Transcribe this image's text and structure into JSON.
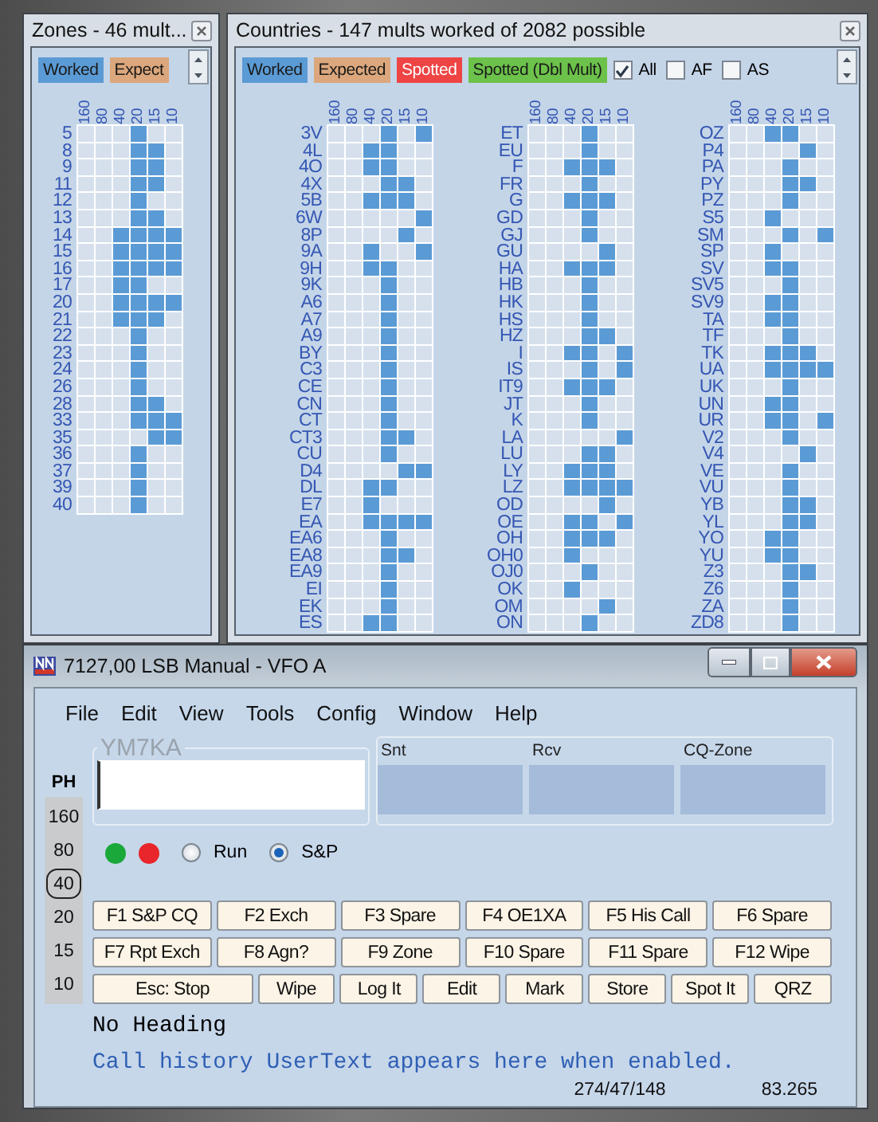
{
  "zones_panel": {
    "title": "Zones - 46 mult...",
    "legend": [
      {
        "label": "Worked",
        "color": "#5b9bd5"
      },
      {
        "label": "Expect",
        "color": "#dca77c"
      }
    ],
    "bands": [
      "160",
      "80",
      "40",
      "20",
      "15",
      "10"
    ],
    "rows": [
      {
        "label": "5",
        "worked": [
          false,
          false,
          false,
          true,
          false,
          false
        ]
      },
      {
        "label": "8",
        "worked": [
          false,
          false,
          false,
          true,
          true,
          false
        ]
      },
      {
        "label": "9",
        "worked": [
          false,
          false,
          false,
          true,
          true,
          false
        ]
      },
      {
        "label": "11",
        "worked": [
          false,
          false,
          false,
          true,
          true,
          false
        ]
      },
      {
        "label": "12",
        "worked": [
          false,
          false,
          false,
          true,
          false,
          false
        ]
      },
      {
        "label": "13",
        "worked": [
          false,
          false,
          false,
          true,
          true,
          false
        ]
      },
      {
        "label": "14",
        "worked": [
          false,
          false,
          true,
          true,
          true,
          true
        ]
      },
      {
        "label": "15",
        "worked": [
          false,
          false,
          true,
          true,
          true,
          true
        ]
      },
      {
        "label": "16",
        "worked": [
          false,
          false,
          true,
          true,
          true,
          true
        ]
      },
      {
        "label": "17",
        "worked": [
          false,
          false,
          true,
          true,
          false,
          false
        ]
      },
      {
        "label": "20",
        "worked": [
          false,
          false,
          true,
          true,
          true,
          true
        ]
      },
      {
        "label": "21",
        "worked": [
          false,
          false,
          true,
          true,
          true,
          false
        ]
      },
      {
        "label": "22",
        "worked": [
          false,
          false,
          false,
          true,
          false,
          false
        ]
      },
      {
        "label": "23",
        "worked": [
          false,
          false,
          false,
          true,
          false,
          false
        ]
      },
      {
        "label": "24",
        "worked": [
          false,
          false,
          false,
          true,
          false,
          false
        ]
      },
      {
        "label": "26",
        "worked": [
          false,
          false,
          false,
          true,
          false,
          false
        ]
      },
      {
        "label": "28",
        "worked": [
          false,
          false,
          false,
          true,
          true,
          false
        ]
      },
      {
        "label": "33",
        "worked": [
          false,
          false,
          false,
          true,
          true,
          true
        ]
      },
      {
        "label": "35",
        "worked": [
          false,
          false,
          false,
          false,
          true,
          true
        ]
      },
      {
        "label": "36",
        "worked": [
          false,
          false,
          false,
          true,
          false,
          false
        ]
      },
      {
        "label": "37",
        "worked": [
          false,
          false,
          false,
          true,
          false,
          false
        ]
      },
      {
        "label": "39",
        "worked": [
          false,
          false,
          false,
          true,
          false,
          false
        ]
      },
      {
        "label": "40",
        "worked": [
          false,
          false,
          false,
          true,
          false,
          false
        ]
      }
    ]
  },
  "countries_panel": {
    "title": "Countries - 147 mults worked of 2082 possible",
    "legend": [
      {
        "label": "Worked",
        "color": "#5b9bd5"
      },
      {
        "label": "Expected",
        "color": "#dca77c"
      },
      {
        "label": "Spotted",
        "color": "#ee4444"
      },
      {
        "label": "Spotted (Dbl Mult)",
        "color": "#6cc24a"
      }
    ],
    "filters": [
      {
        "label": "All",
        "checked": true
      },
      {
        "label": "AF",
        "checked": false
      },
      {
        "label": "AS",
        "checked": false
      }
    ],
    "columns": [
      {
        "bands": [
          "160",
          "80",
          "40",
          "20",
          "15",
          "10"
        ],
        "rows": [
          {
            "label": "3V",
            "worked": [
              false,
              false,
              false,
              true,
              false,
              true
            ]
          },
          {
            "label": "4L",
            "worked": [
              false,
              false,
              true,
              true,
              false,
              false
            ]
          },
          {
            "label": "4O",
            "worked": [
              false,
              false,
              true,
              true,
              false,
              false
            ]
          },
          {
            "label": "4X",
            "worked": [
              false,
              false,
              false,
              true,
              true,
              false
            ]
          },
          {
            "label": "5B",
            "worked": [
              false,
              false,
              true,
              true,
              true,
              false
            ]
          },
          {
            "label": "6W",
            "worked": [
              false,
              false,
              false,
              false,
              false,
              true
            ]
          },
          {
            "label": "8P",
            "worked": [
              false,
              false,
              false,
              false,
              true,
              false
            ]
          },
          {
            "label": "9A",
            "worked": [
              false,
              false,
              true,
              false,
              false,
              true
            ]
          },
          {
            "label": "9H",
            "worked": [
              false,
              false,
              true,
              true,
              false,
              false
            ]
          },
          {
            "label": "9K",
            "worked": [
              false,
              false,
              false,
              true,
              false,
              false
            ]
          },
          {
            "label": "A6",
            "worked": [
              false,
              false,
              false,
              true,
              false,
              false
            ]
          },
          {
            "label": "A7",
            "worked": [
              false,
              false,
              false,
              true,
              false,
              false
            ]
          },
          {
            "label": "A9",
            "worked": [
              false,
              false,
              false,
              true,
              false,
              false
            ]
          },
          {
            "label": "BY",
            "worked": [
              false,
              false,
              false,
              true,
              false,
              false
            ]
          },
          {
            "label": "C3",
            "worked": [
              false,
              false,
              false,
              true,
              false,
              false
            ]
          },
          {
            "label": "CE",
            "worked": [
              false,
              false,
              false,
              true,
              false,
              false
            ]
          },
          {
            "label": "CN",
            "worked": [
              false,
              false,
              false,
              true,
              false,
              false
            ]
          },
          {
            "label": "CT",
            "worked": [
              false,
              false,
              false,
              true,
              false,
              false
            ]
          },
          {
            "label": "CT3",
            "worked": [
              false,
              false,
              false,
              true,
              true,
              false
            ]
          },
          {
            "label": "CU",
            "worked": [
              false,
              false,
              false,
              true,
              false,
              false
            ]
          },
          {
            "label": "D4",
            "worked": [
              false,
              false,
              false,
              false,
              true,
              true
            ]
          },
          {
            "label": "DL",
            "worked": [
              false,
              false,
              true,
              true,
              false,
              false
            ]
          },
          {
            "label": "E7",
            "worked": [
              false,
              false,
              true,
              false,
              false,
              false
            ]
          },
          {
            "label": "EA",
            "worked": [
              false,
              false,
              true,
              true,
              true,
              true
            ]
          },
          {
            "label": "EA6",
            "worked": [
              false,
              false,
              false,
              true,
              false,
              false
            ]
          },
          {
            "label": "EA8",
            "worked": [
              false,
              false,
              false,
              true,
              true,
              false
            ]
          },
          {
            "label": "EA9",
            "worked": [
              false,
              false,
              false,
              true,
              false,
              false
            ]
          },
          {
            "label": "EI",
            "worked": [
              false,
              false,
              false,
              true,
              false,
              false
            ]
          },
          {
            "label": "EK",
            "worked": [
              false,
              false,
              false,
              true,
              false,
              false
            ]
          },
          {
            "label": "ES",
            "worked": [
              false,
              false,
              true,
              true,
              false,
              false
            ]
          }
        ]
      },
      {
        "bands": [
          "160",
          "80",
          "40",
          "20",
          "15",
          "10"
        ],
        "rows": [
          {
            "label": "ET",
            "worked": [
              false,
              false,
              false,
              true,
              false,
              false
            ]
          },
          {
            "label": "EU",
            "worked": [
              false,
              false,
              false,
              true,
              false,
              false
            ]
          },
          {
            "label": "F",
            "worked": [
              false,
              false,
              true,
              true,
              true,
              false
            ]
          },
          {
            "label": "FR",
            "worked": [
              false,
              false,
              false,
              true,
              false,
              false
            ]
          },
          {
            "label": "G",
            "worked": [
              false,
              false,
              true,
              true,
              true,
              false
            ]
          },
          {
            "label": "GD",
            "worked": [
              false,
              false,
              false,
              true,
              false,
              false
            ]
          },
          {
            "label": "GJ",
            "worked": [
              false,
              false,
              false,
              true,
              false,
              false
            ]
          },
          {
            "label": "GU",
            "worked": [
              false,
              false,
              false,
              false,
              true,
              false
            ]
          },
          {
            "label": "HA",
            "worked": [
              false,
              false,
              true,
              true,
              true,
              false
            ]
          },
          {
            "label": "HB",
            "worked": [
              false,
              false,
              false,
              true,
              false,
              false
            ]
          },
          {
            "label": "HK",
            "worked": [
              false,
              false,
              false,
              true,
              false,
              false
            ]
          },
          {
            "label": "HS",
            "worked": [
              false,
              false,
              false,
              true,
              false,
              false
            ]
          },
          {
            "label": "HZ",
            "worked": [
              false,
              false,
              false,
              true,
              true,
              false
            ]
          },
          {
            "label": "I",
            "worked": [
              false,
              false,
              true,
              true,
              false,
              true
            ]
          },
          {
            "label": "IS",
            "worked": [
              false,
              false,
              false,
              true,
              false,
              true
            ]
          },
          {
            "label": "IT9",
            "worked": [
              false,
              false,
              true,
              true,
              true,
              false
            ]
          },
          {
            "label": "JT",
            "worked": [
              false,
              false,
              false,
              true,
              false,
              false
            ]
          },
          {
            "label": "K",
            "worked": [
              false,
              false,
              false,
              true,
              false,
              false
            ]
          },
          {
            "label": "LA",
            "worked": [
              false,
              false,
              false,
              false,
              false,
              true
            ]
          },
          {
            "label": "LU",
            "worked": [
              false,
              false,
              false,
              true,
              true,
              false
            ]
          },
          {
            "label": "LY",
            "worked": [
              false,
              false,
              true,
              true,
              true,
              false
            ]
          },
          {
            "label": "LZ",
            "worked": [
              false,
              false,
              true,
              true,
              true,
              true
            ]
          },
          {
            "label": "OD",
            "worked": [
              false,
              false,
              false,
              false,
              true,
              false
            ]
          },
          {
            "label": "OE",
            "worked": [
              false,
              false,
              true,
              true,
              false,
              true
            ]
          },
          {
            "label": "OH",
            "worked": [
              false,
              false,
              true,
              true,
              true,
              false
            ]
          },
          {
            "label": "OH0",
            "worked": [
              false,
              false,
              true,
              false,
              false,
              false
            ]
          },
          {
            "label": "OJ0",
            "worked": [
              false,
              false,
              false,
              true,
              false,
              false
            ]
          },
          {
            "label": "OK",
            "worked": [
              false,
              false,
              true,
              false,
              false,
              false
            ]
          },
          {
            "label": "OM",
            "worked": [
              false,
              false,
              false,
              false,
              true,
              false
            ]
          },
          {
            "label": "ON",
            "worked": [
              false,
              false,
              false,
              true,
              false,
              false
            ]
          }
        ]
      },
      {
        "bands": [
          "160",
          "80",
          "40",
          "20",
          "15",
          "10"
        ],
        "rows": [
          {
            "label": "OZ",
            "worked": [
              false,
              false,
              true,
              true,
              false,
              false
            ]
          },
          {
            "label": "P4",
            "worked": [
              false,
              false,
              false,
              false,
              true,
              false
            ]
          },
          {
            "label": "PA",
            "worked": [
              false,
              false,
              false,
              true,
              false,
              false
            ]
          },
          {
            "label": "PY",
            "worked": [
              false,
              false,
              false,
              true,
              true,
              false
            ]
          },
          {
            "label": "PZ",
            "worked": [
              false,
              false,
              false,
              true,
              false,
              false
            ]
          },
          {
            "label": "S5",
            "worked": [
              false,
              false,
              true,
              false,
              false,
              false
            ]
          },
          {
            "label": "SM",
            "worked": [
              false,
              false,
              false,
              true,
              false,
              true
            ]
          },
          {
            "label": "SP",
            "worked": [
              false,
              false,
              true,
              false,
              false,
              false
            ]
          },
          {
            "label": "SV",
            "worked": [
              false,
              false,
              true,
              true,
              false,
              false
            ]
          },
          {
            "label": "SV5",
            "worked": [
              false,
              false,
              false,
              true,
              false,
              false
            ]
          },
          {
            "label": "SV9",
            "worked": [
              false,
              false,
              true,
              true,
              false,
              false
            ]
          },
          {
            "label": "TA",
            "worked": [
              false,
              false,
              true,
              true,
              false,
              false
            ]
          },
          {
            "label": "TF",
            "worked": [
              false,
              false,
              false,
              true,
              false,
              false
            ]
          },
          {
            "label": "TK",
            "worked": [
              false,
              false,
              true,
              true,
              true,
              false
            ]
          },
          {
            "label": "UA",
            "worked": [
              false,
              false,
              true,
              true,
              true,
              true
            ]
          },
          {
            "label": "UK",
            "worked": [
              false,
              false,
              false,
              true,
              false,
              false
            ]
          },
          {
            "label": "UN",
            "worked": [
              false,
              false,
              true,
              true,
              false,
              false
            ]
          },
          {
            "label": "UR",
            "worked": [
              false,
              false,
              true,
              true,
              false,
              true
            ]
          },
          {
            "label": "V2",
            "worked": [
              false,
              false,
              false,
              true,
              false,
              false
            ]
          },
          {
            "label": "V4",
            "worked": [
              false,
              false,
              false,
              false,
              true,
              false
            ]
          },
          {
            "label": "VE",
            "worked": [
              false,
              false,
              false,
              true,
              false,
              false
            ]
          },
          {
            "label": "VU",
            "worked": [
              false,
              false,
              false,
              true,
              false,
              false
            ]
          },
          {
            "label": "YB",
            "worked": [
              false,
              false,
              false,
              true,
              true,
              false
            ]
          },
          {
            "label": "YL",
            "worked": [
              false,
              false,
              false,
              true,
              true,
              false
            ]
          },
          {
            "label": "YO",
            "worked": [
              false,
              false,
              true,
              true,
              false,
              false
            ]
          },
          {
            "label": "YU",
            "worked": [
              false,
              false,
              true,
              true,
              false,
              false
            ]
          },
          {
            "label": "Z3",
            "worked": [
              false,
              false,
              false,
              true,
              true,
              false
            ]
          },
          {
            "label": "Z6",
            "worked": [
              false,
              false,
              false,
              true,
              false,
              false
            ]
          },
          {
            "label": "ZA",
            "worked": [
              false,
              false,
              false,
              true,
              false,
              false
            ]
          },
          {
            "label": "ZD8",
            "worked": [
              false,
              false,
              false,
              true,
              false,
              false
            ]
          }
        ]
      }
    ]
  },
  "logger": {
    "title": "7127,00 LSB Manual - VFO A",
    "menu": [
      "File",
      "Edit",
      "View",
      "Tools",
      "Config",
      "Window",
      "Help"
    ],
    "mode": "PH",
    "bands": [
      {
        "label": "160",
        "selected": false
      },
      {
        "label": "80",
        "selected": false
      },
      {
        "label": "40",
        "selected": true
      },
      {
        "label": "20",
        "selected": false
      },
      {
        "label": "15",
        "selected": false
      },
      {
        "label": "10",
        "selected": false
      }
    ],
    "call_field": {
      "label": "YM7KA"
    },
    "exchange_fields": [
      {
        "label": "Snt"
      },
      {
        "label": "Rcv"
      },
      {
        "label": "CQ-Zone"
      }
    ],
    "indicators": [
      {
        "color": "#1aa83a"
      },
      {
        "color": "#e8262b"
      }
    ],
    "radios": [
      {
        "label": "Run",
        "selected": false
      },
      {
        "label": "S&P",
        "selected": true
      }
    ],
    "function_keys": [
      [
        "F1 S&P CQ",
        "F2 Exch",
        "F3 Spare",
        "F4 OE1XA",
        "F5 His Call",
        "F6 Spare"
      ],
      [
        "F7 Rpt Exch",
        "F8 Agn?",
        "F9 Zone",
        "F10 Spare",
        "F11 Spare",
        "F12 Wipe"
      ]
    ],
    "buttons": [
      "Esc: Stop",
      "Wipe",
      "Log It",
      "Edit",
      "Mark",
      "Store",
      "Spot It",
      "QRZ"
    ],
    "heading": "No Heading",
    "user_text": "Call history UserText appears here when enabled.",
    "status": [
      "274/47/148",
      "83.265"
    ]
  }
}
